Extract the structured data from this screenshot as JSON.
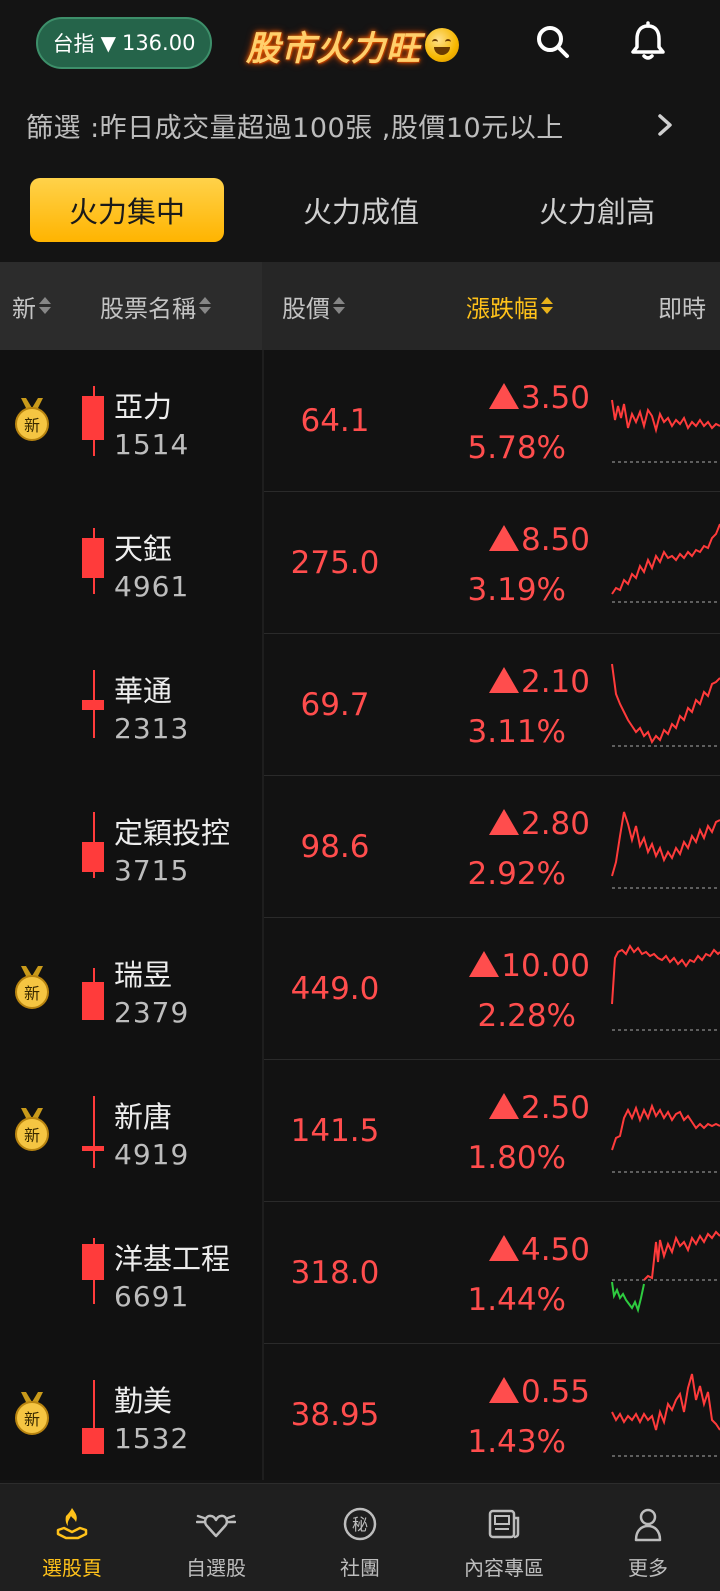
{
  "header": {
    "index_label": "台指",
    "index_arrow": "▼",
    "index_value": "136.00",
    "logo_text": "股市火力旺",
    "icons": [
      "search-icon",
      "bell-icon"
    ]
  },
  "filter": {
    "text": "篩選 :昨日成交量超過100張 ,股價10元以上",
    "chevron": "chevron-right-icon"
  },
  "tabs": [
    {
      "label": "火力集中",
      "active": true
    },
    {
      "label": "火力成值",
      "active": false
    },
    {
      "label": "火力創高",
      "active": false
    }
  ],
  "columns": {
    "new": "新",
    "name": "股票名稱",
    "price": "股價",
    "change": "漲跌幅",
    "realtime": "即時"
  },
  "medal_label": "新",
  "rows": [
    {
      "name": "亞力",
      "code": "1514",
      "price": "64.1",
      "change": "3.50",
      "pct": "5.78%",
      "is_new": true
    },
    {
      "name": "天鈺",
      "code": "4961",
      "price": "275.0",
      "change": "8.50",
      "pct": "3.19%",
      "is_new": false
    },
    {
      "name": "華通",
      "code": "2313",
      "price": "69.7",
      "change": "2.10",
      "pct": "3.11%",
      "is_new": false
    },
    {
      "name": "定穎投控",
      "code": "3715",
      "price": "98.6",
      "change": "2.80",
      "pct": "2.92%",
      "is_new": false
    },
    {
      "name": "瑞昱",
      "code": "2379",
      "price": "449.0",
      "change": "10.00",
      "pct": "2.28%",
      "is_new": true
    },
    {
      "name": "新唐",
      "code": "4919",
      "price": "141.5",
      "change": "2.50",
      "pct": "1.80%",
      "is_new": true
    },
    {
      "name": "洋基工程",
      "code": "6691",
      "price": "318.0",
      "change": "4.50",
      "pct": "1.44%",
      "is_new": false
    },
    {
      "name": "勤美",
      "code": "1532",
      "price": "38.95",
      "change": "0.55",
      "pct": "1.43%",
      "is_new": true
    }
  ],
  "bottom_nav": [
    {
      "label": "選股頁",
      "icon": "hand-flame-icon",
      "active": true
    },
    {
      "label": "自選股",
      "icon": "winged-heart-icon",
      "active": false
    },
    {
      "label": "社團",
      "icon": "secret-circle-icon",
      "active": false
    },
    {
      "label": "內容專區",
      "icon": "newspaper-icon",
      "active": false
    },
    {
      "label": "更多",
      "icon": "person-icon",
      "active": false
    }
  ],
  "colors": {
    "up": "#ff4d4d",
    "down": "#2ecc40",
    "accent": "#ffc21a",
    "index_pill": "#25644a"
  }
}
